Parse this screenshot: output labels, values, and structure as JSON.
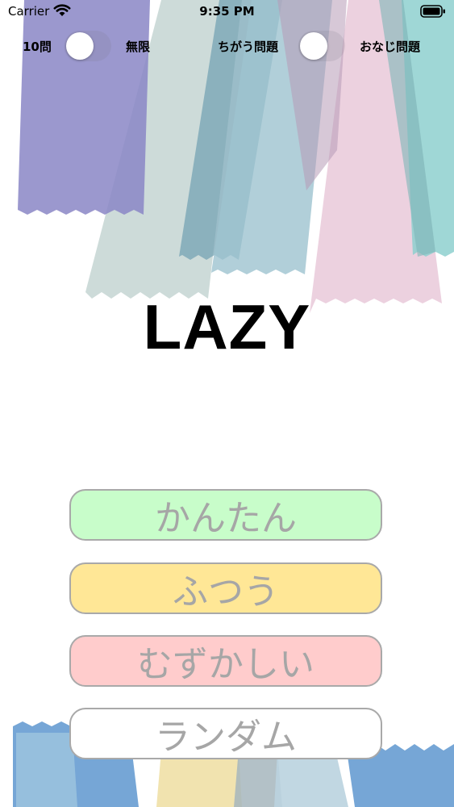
{
  "status_bar": {
    "carrier": "Carrier",
    "time": "9:35 PM",
    "icons": [
      "wifi-icon",
      "battery-icon"
    ]
  },
  "settings": {
    "count_toggle": {
      "left_label": "10問",
      "right_label": "無限",
      "on": false
    },
    "mode_toggle": {
      "left_label": "ちがう問題",
      "right_label": "おなじ問題",
      "on": false
    }
  },
  "title": "LAZY",
  "difficulty_buttons": [
    {
      "label": "かんたん",
      "color": "#c8fdca"
    },
    {
      "label": "ふつう",
      "color": "#ffe796"
    },
    {
      "label": "むずかしい",
      "color": "#ffcccc"
    },
    {
      "label": "ランダム",
      "color": "#ffffff"
    }
  ],
  "colors": {
    "button_border": "#a9a9a9",
    "button_text": "#a6a6a6",
    "ribbon_purple": "#8a86c6",
    "ribbon_teal": "#6f9fb0",
    "ribbon_pink": "#e6c2d4",
    "ribbon_mint": "#8ed0cf",
    "ribbon_blue": "#5e97cf",
    "ribbon_yellow": "#efe0a6"
  }
}
